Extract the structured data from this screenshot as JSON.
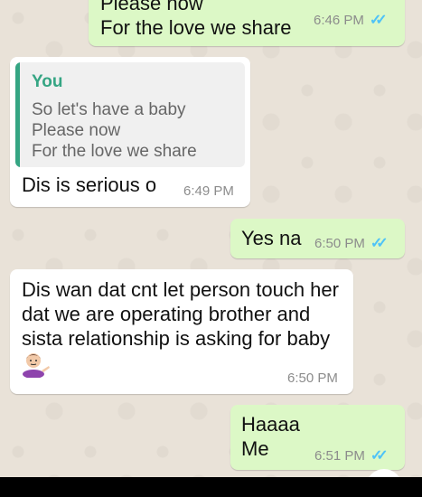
{
  "messages": [
    {
      "id": "m1",
      "direction": "outgoing",
      "text": "Please now\nFor the love we share",
      "time": "6:46 PM",
      "status": "read"
    },
    {
      "id": "m2",
      "direction": "incoming",
      "quote": {
        "author": "You",
        "text": "So let's have a baby\nPlease now\nFor the love we share"
      },
      "text": "Dis is serious o",
      "time": "6:49 PM"
    },
    {
      "id": "m3",
      "direction": "outgoing",
      "text": "Yes na",
      "time": "6:50 PM",
      "status": "read"
    },
    {
      "id": "m4",
      "direction": "incoming",
      "text": "Dis wan dat cnt let person touch her dat we are operating brother and sista relationship is asking for baby",
      "emoji": "man-shrugging-emoji",
      "time": "6:50 PM"
    },
    {
      "id": "m5",
      "direction": "outgoing",
      "text": "Haaaa\nMe",
      "time": "6:51 PM",
      "status": "read"
    }
  ],
  "colors": {
    "outgoing_bubble": "#dcf8c6",
    "incoming_bubble": "#ffffff",
    "quote_accent": "#35a583",
    "read_ticks": "#4fc3f7",
    "chat_background": "#e9e2d8"
  }
}
